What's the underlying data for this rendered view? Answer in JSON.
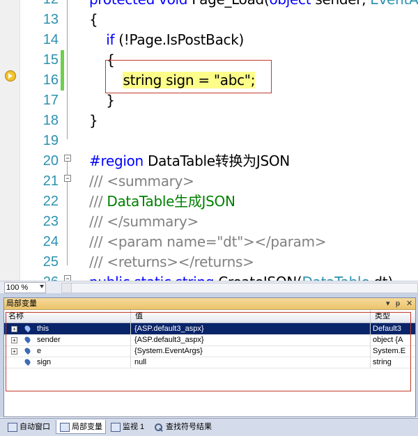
{
  "editor": {
    "line_numbers": [
      "12",
      "13",
      "14",
      "15",
      "16",
      "17",
      "18",
      "19",
      "20",
      "21",
      "22",
      "23",
      "24",
      "25",
      "26"
    ],
    "lines": [
      [
        {
          "c": "kw",
          "t": "protected void "
        },
        {
          "c": "",
          "t": "Page_Load("
        },
        {
          "c": "kw",
          "t": "object"
        },
        {
          "c": "",
          "t": " sender, "
        },
        {
          "c": "ty",
          "t": "EventA"
        }
      ],
      [
        {
          "c": "",
          "t": "{"
        }
      ],
      [
        {
          "c": "",
          "t": "    "
        },
        {
          "c": "kw",
          "t": "if"
        },
        {
          "c": "",
          "t": " (!Page.IsPostBack)"
        }
      ],
      [
        {
          "c": "",
          "t": "    {"
        }
      ],
      [
        {
          "c": "",
          "t": "        "
        },
        {
          "c": "hl",
          "t": "string sign = \"abc\";"
        }
      ],
      [
        {
          "c": "",
          "t": "    }"
        }
      ],
      [
        {
          "c": "",
          "t": "}"
        }
      ],
      [
        {
          "c": "",
          "t": ""
        }
      ],
      [
        {
          "c": "kw",
          "t": "#region"
        },
        {
          "c": "",
          "t": " DataTable转换为JSON"
        }
      ],
      [
        {
          "c": "cm",
          "t": "/// <summary>"
        }
      ],
      [
        {
          "c": "cm",
          "t": "/// "
        },
        {
          "c": "cg",
          "t": "DataTable生成JSON"
        }
      ],
      [
        {
          "c": "cm",
          "t": "/// </summary>"
        }
      ],
      [
        {
          "c": "cm",
          "t": "/// <param name=\"dt\"></param>"
        }
      ],
      [
        {
          "c": "cm",
          "t": "/// <returns></returns>"
        }
      ],
      [
        {
          "c": "kw",
          "t": "public static string "
        },
        {
          "c": "",
          "t": "CreateJSON("
        },
        {
          "c": "ty",
          "t": "DataTable"
        },
        {
          "c": "",
          "t": " dt)"
        }
      ]
    ],
    "zoom": "100 %"
  },
  "locals": {
    "title": "局部变量",
    "controls": [
      "▾",
      "ᵽ",
      "✕"
    ],
    "columns": [
      "名称",
      "值",
      "类型"
    ],
    "rows": [
      {
        "expandable": true,
        "name": "this",
        "value": "{ASP.default3_aspx}",
        "type": "Default3",
        "selected": true
      },
      {
        "expandable": true,
        "name": "sender",
        "value": "{ASP.default3_aspx}",
        "type": "object {A",
        "selected": false
      },
      {
        "expandable": true,
        "name": "e",
        "value": "{System.EventArgs}",
        "type": "System.E",
        "selected": false
      },
      {
        "expandable": false,
        "name": "sign",
        "value": "null",
        "type": "string",
        "selected": false
      }
    ]
  },
  "tabs": [
    {
      "label": "自动窗口",
      "icon": "window-icon",
      "active": false
    },
    {
      "label": "局部变量",
      "icon": "locals-icon",
      "active": true
    },
    {
      "label": "监视 1",
      "icon": "watch-icon",
      "active": false
    },
    {
      "label": "查找符号结果",
      "icon": "find-symbol-icon",
      "active": false
    }
  ]
}
